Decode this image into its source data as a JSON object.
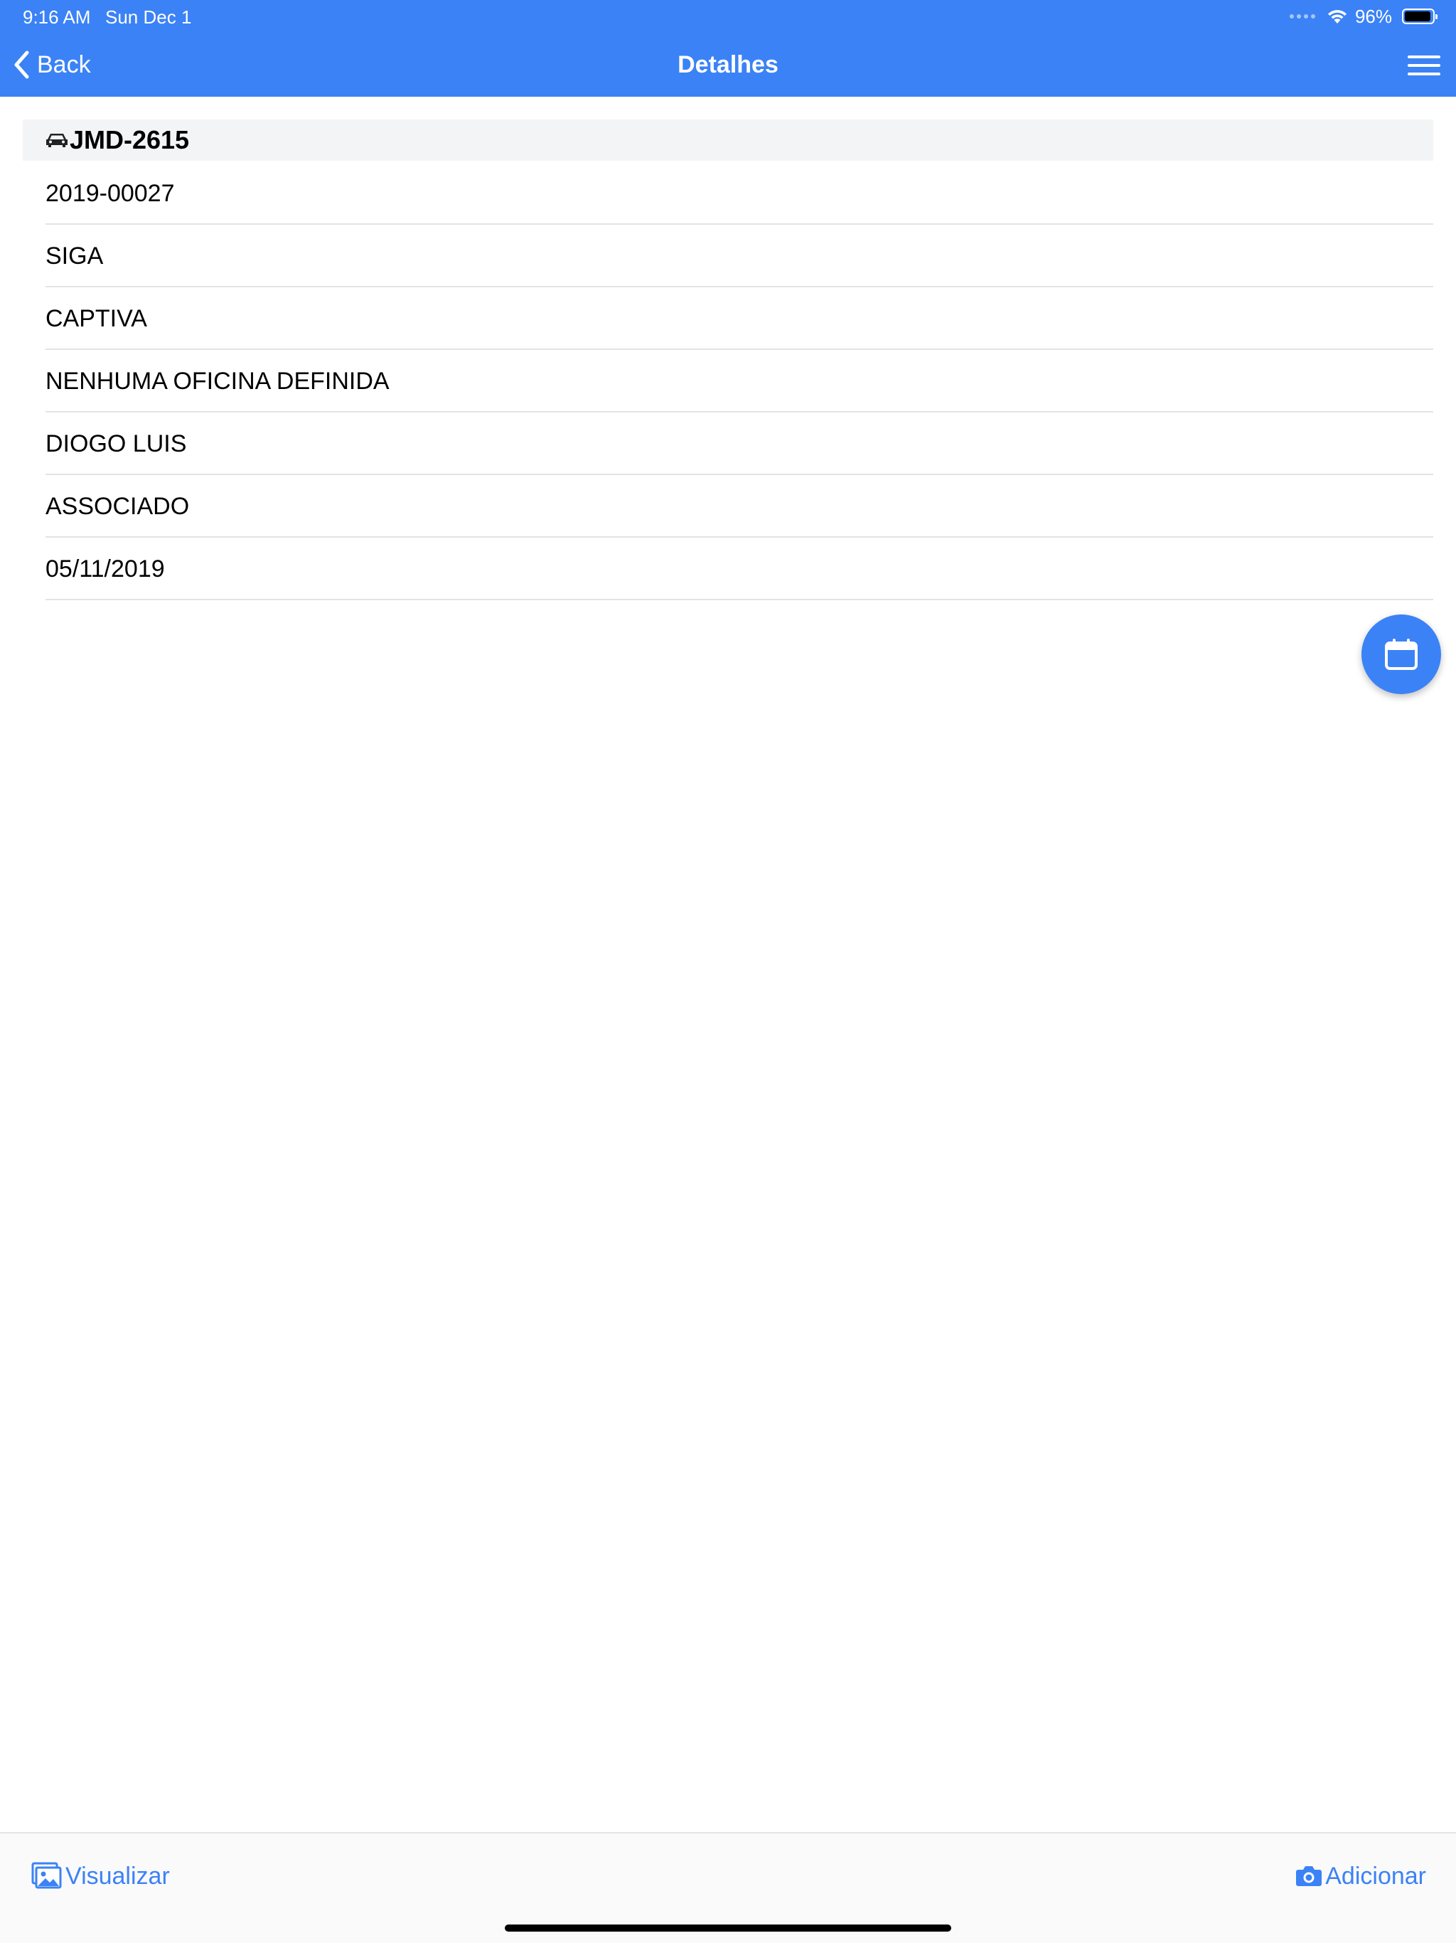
{
  "status_bar": {
    "time": "9:16 AM",
    "date": "Sun Dec 1",
    "battery_percent": "96%",
    "battery_level": 0.96
  },
  "nav": {
    "back_label": "Back",
    "title": "Detalhes",
    "menu_icon": "hamburger-menu-icon"
  },
  "vehicle": {
    "icon": "car-icon",
    "plate": "JMD-2615"
  },
  "details": [
    "2019-00027",
    "SIGA",
    "CAPTIVA",
    "NENHUMA OFICINA DEFINIDA",
    "DIOGO LUIS",
    "ASSOCIADO",
    "05/11/2019"
  ],
  "fab": {
    "icon": "calendar-icon"
  },
  "toolbar": {
    "view_label": "Visualizar",
    "add_label": "Adicionar"
  },
  "colors": {
    "accent": "#3b82f6",
    "section_bg": "#f3f4f6",
    "separator": "#e3e3e6"
  }
}
